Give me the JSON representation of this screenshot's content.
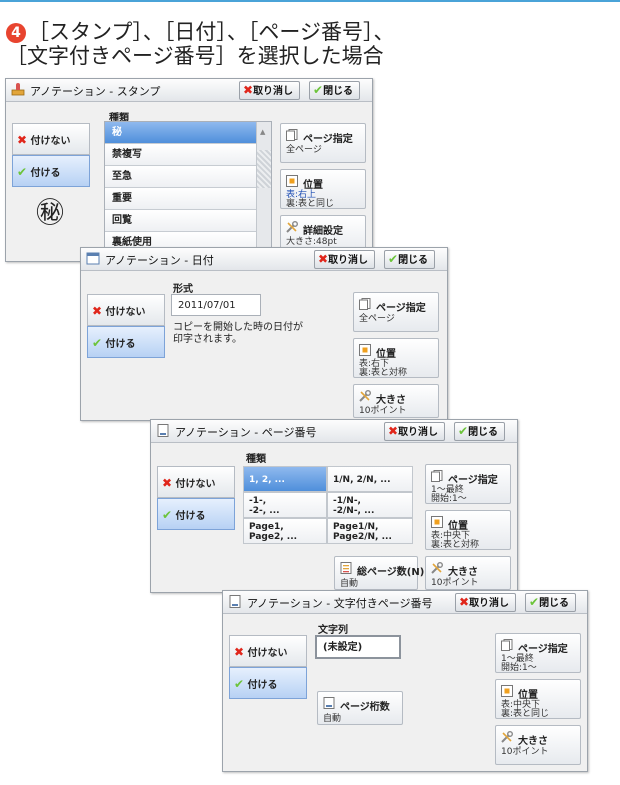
{
  "heading": {
    "step_number": "4",
    "line1": "［スタンプ］、［日付］、［ページ番号］、",
    "line2": "［文字付きページ番号］を選択した場合"
  },
  "colors": {
    "accent_line": "#4aa3d8",
    "step_badge": "#e8442f",
    "selected": "#4f8fdb"
  },
  "panel1": {
    "title": "アノテーション - スタンプ",
    "cancel": "取り消し",
    "close": "閉じる",
    "list_header": "種類",
    "off": "付けない",
    "on": "付ける",
    "stamp_preview": "㊙",
    "items": [
      "秘",
      "禁複写",
      "至急",
      "重要",
      "回覧",
      "裏紙使用"
    ],
    "page_spec_title": "ページ指定",
    "page_spec_value": "全ページ",
    "position_title": "位置",
    "position_line1": "表:右上",
    "position_line2": "裏:表と同じ",
    "detail_title": "詳細設定",
    "detail_line1": "大きさ:48pt"
  },
  "panel2": {
    "title": "アノテーション - 日付",
    "cancel": "取り消し",
    "close": "閉じる",
    "format_label": "形式",
    "date_value": "2011/07/01",
    "note_line1": "コピーを開始した時の日付が",
    "note_line2": "印字されます。",
    "off": "付けない",
    "on": "付ける",
    "page_spec_title": "ページ指定",
    "page_spec_value": "全ページ",
    "position_title": "位置",
    "position_line1": "表:右下",
    "position_line2": "裏:表と対称",
    "size_title": "大きさ",
    "size_value": "10ポイント"
  },
  "panel3": {
    "title": "アノテーション - ページ番号",
    "cancel": "取り消し",
    "close": "閉じる",
    "list_header": "種類",
    "off": "付けない",
    "on": "付ける",
    "cells": [
      [
        "1, 2, ...",
        ""
      ],
      [
        "1/N, 2/N, ...",
        ""
      ],
      [
        "-1-,",
        "-2-, ..."
      ],
      [
        "-1/N-,",
        "-2/N-, ..."
      ],
      [
        "Page1,",
        "Page2, ..."
      ],
      [
        "Page1/N,",
        "Page2/N, ..."
      ]
    ],
    "total_pages_title": "総ページ数(N)",
    "total_pages_value": "自動",
    "page_spec_title": "ページ指定",
    "page_spec_line1": "1～最終",
    "page_spec_line2": "開始:1～",
    "position_title": "位置",
    "position_line1": "表:中央下",
    "position_line2": "裏:表と対称",
    "size_title": "大きさ",
    "size_value": "10ポイント"
  },
  "panel4": {
    "title": "アノテーション - 文字付きページ番号",
    "cancel": "取り消し",
    "close": "閉じる",
    "string_label": "文字列",
    "string_value": "(未設定)",
    "off": "付けない",
    "on": "付ける",
    "digits_title": "ページ桁数",
    "digits_value": "自動",
    "page_spec_title": "ページ指定",
    "page_spec_line1": "1～最終",
    "page_spec_line2": "開始:1～",
    "position_title": "位置",
    "position_line1": "表:中央下",
    "position_line2": "裏:表と同じ",
    "size_title": "大きさ",
    "size_value": "10ポイント"
  }
}
